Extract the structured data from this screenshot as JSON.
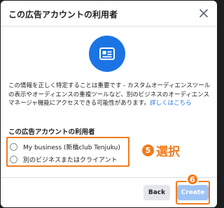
{
  "dialog": {
    "title": "この広告アカウントの利用者",
    "close_icon": "close-icon",
    "hero_icon": "ad-account-card-icon",
    "description": "この情報を正しく特定することは重要です - カスタムオーディエンスツールの表示やオーディエンスの重複ツールなど、別のビジネスのオーディエンスマネージャ機能にアクセスできる可能性があります。",
    "description_link": "詳しくはこちら",
    "section_label": "この広告アカウントの利用者",
    "options": [
      {
        "label": "My business (新橋club Tenjuku)",
        "selected": false
      },
      {
        "label": "別のビジネスまたはクライアント",
        "selected": false
      }
    ],
    "back_label": "Back",
    "create_label": "Create"
  },
  "annotations": {
    "select_number": "5",
    "select_text": "選択",
    "create_number": "6"
  },
  "colors": {
    "accent_blue": "#1b74e4",
    "annotation_orange": "#f07c1e",
    "create_disabled": "#9ec4f5"
  }
}
